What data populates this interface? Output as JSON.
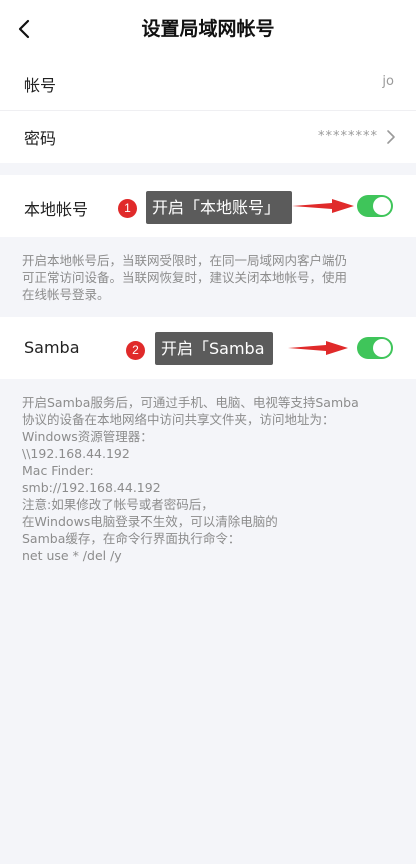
{
  "header": {
    "title": "设置局域网帐号",
    "back_icon": "chevron-left-icon"
  },
  "account": {
    "label": "帐号",
    "value": "jo"
  },
  "password": {
    "label": "密码",
    "value": "********",
    "chevron_icon": "chevron-right-icon"
  },
  "local_account": {
    "label": "本地帐号",
    "enabled": true,
    "description": [
      "开启本地帐号后，当联网受限时，在同一局域网内客户端仍",
      "可正常访问设备。当联网恢复时，建议关闭本地帐号，使用",
      "在线帐号登录。"
    ]
  },
  "samba": {
    "label": "Samba",
    "enabled": true,
    "description": [
      "开启Samba服务后，可通过手机、电脑、电视等支持Samba",
      "协议的设备在本地网络中访问共享文件夹，访问地址为：",
      "Windows资源管理器：",
      "\\\\192.168.44.192",
      "Mac Finder:",
      "smb://192.168.44.192",
      "注意:如果修改了帐号或者密码后，",
      "在Windows电脑登录不生效，可以清除电脑的",
      "Samba缓存，在命令行界面执行命令：",
      "net use * /del /y"
    ]
  },
  "annotations": {
    "step1": {
      "number": "1",
      "text": "开启「本地账号」"
    },
    "step2": {
      "number": "2",
      "text": "开启「Samba"
    },
    "badge_color": "#e02a2a",
    "arrow_color": "#e02a2a",
    "callout_color": "#5b5b5b"
  },
  "colors": {
    "toggle_on": "#3fc55a",
    "background": "#f4f5f9"
  }
}
